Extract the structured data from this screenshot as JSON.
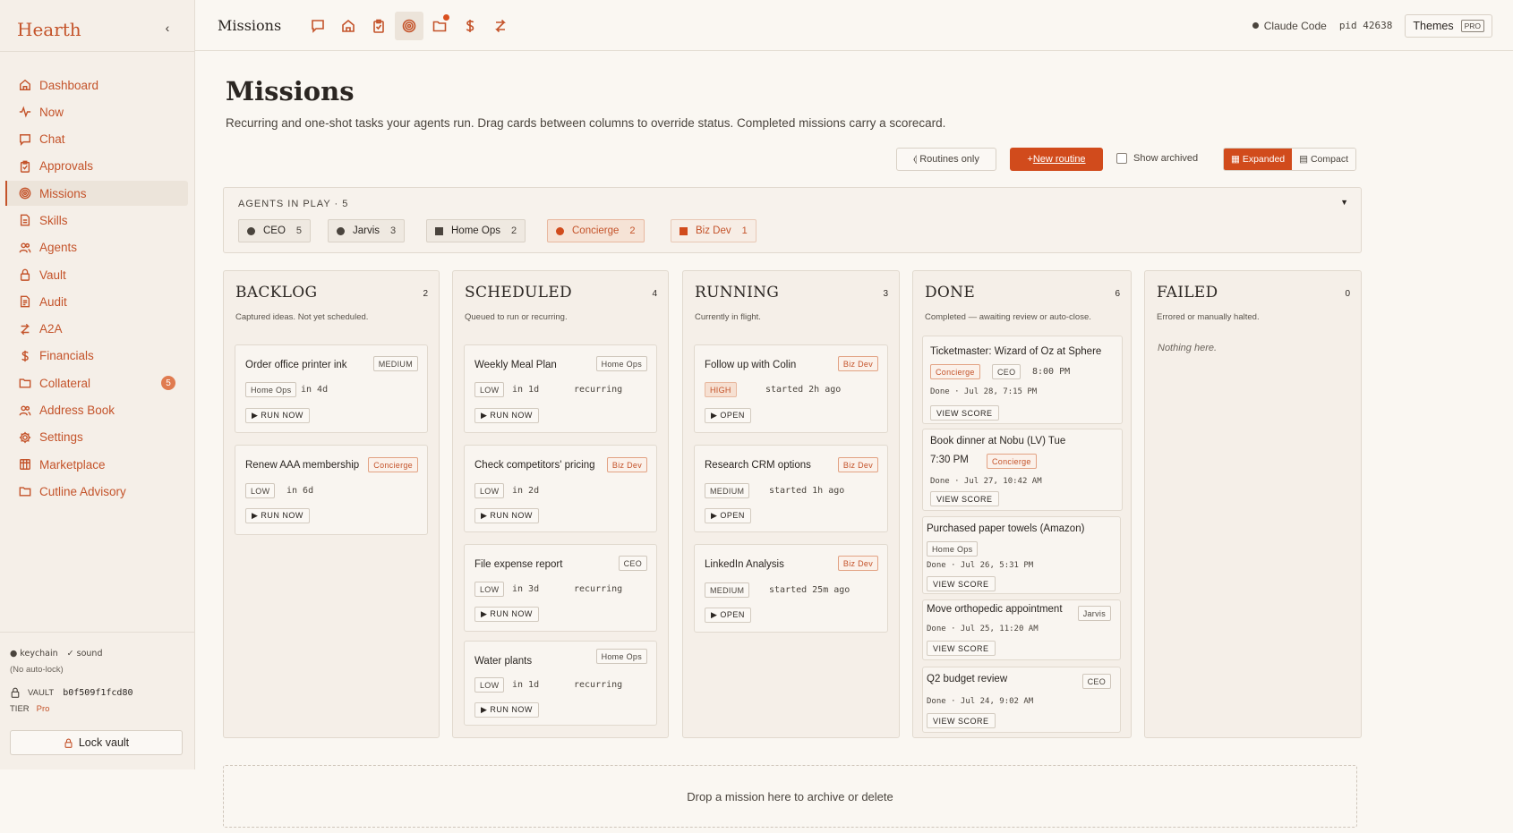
{
  "app": {
    "brand": "Hearth",
    "collapse_glyph": "‹"
  },
  "sidebar": {
    "items": [
      {
        "label": "Dashboard",
        "icon": "home-icon"
      },
      {
        "label": "Now",
        "icon": "pulse-icon"
      },
      {
        "label": "Chat",
        "icon": "chat-icon"
      },
      {
        "label": "Approvals",
        "icon": "clipboard-icon"
      },
      {
        "label": "Missions",
        "icon": "target-icon"
      },
      {
        "label": "Skills",
        "icon": "document-icon"
      },
      {
        "label": "Agents",
        "icon": "users-icon"
      },
      {
        "label": "Vault",
        "icon": "lock-icon"
      },
      {
        "label": "Audit",
        "icon": "file-icon"
      },
      {
        "label": "A2A",
        "icon": "exchange-icon"
      },
      {
        "label": "Financials",
        "icon": "dollar-icon"
      },
      {
        "label": "Collateral",
        "icon": "folder-icon",
        "badge": "5"
      },
      {
        "label": "Address Book",
        "icon": "contacts-icon"
      },
      {
        "label": "Settings",
        "icon": "gear-icon"
      },
      {
        "label": "Marketplace",
        "icon": "store-icon"
      },
      {
        "label": "Cutline Advisory",
        "icon": "folder-icon"
      }
    ],
    "status_keychain": "● keychain",
    "status_sound": "✓ sound",
    "autolock": "(No auto-lock)",
    "vault_label": "VAULT",
    "vault_id": "b0f509f1fcd80",
    "tier_label": "TIER",
    "tier_value": "Pro",
    "lock_button": "Lock vault"
  },
  "topbar": {
    "title": "Missions",
    "session_name": "Claude Code",
    "pid": "pid 42638",
    "themes_label": "Themes",
    "themes_badge": "PRO"
  },
  "page": {
    "title": "Missions",
    "subtitle": "Recurring and one-shot tasks your agents run. Drag cards between columns to override status. Completed missions carry a scorecard."
  },
  "toolbar": {
    "routines_only": "⦉ Routines only",
    "new_routine_plus": "+ ",
    "new_routine": "New routine",
    "show_archived": "Show archived",
    "expanded": "▦ Expanded",
    "compact": "▤ Compact"
  },
  "agents": {
    "label": "AGENTS IN PLAY · 5",
    "caret": "▼",
    "chips": [
      {
        "name": "CEO",
        "count": "5"
      },
      {
        "name": "Jarvis",
        "count": "3"
      },
      {
        "name": "Home Ops",
        "count": "2"
      },
      {
        "name": "Concierge",
        "count": "2"
      },
      {
        "name": "Biz Dev",
        "count": "1"
      }
    ]
  },
  "columns": {
    "backlog": {
      "title": "BACKLOG",
      "count": "2",
      "sub": "Captured ideas. Not yet scheduled.",
      "cards": [
        {
          "title": "Order office printer ink",
          "tag": "MEDIUM",
          "agent": "Home Ops",
          "when": "in 4d",
          "action": "▶ RUN NOW"
        },
        {
          "title": "Renew AAA membership",
          "agent": "Concierge",
          "priority": "LOW",
          "when": "in 6d",
          "action": "▶ RUN NOW"
        }
      ]
    },
    "scheduled": {
      "title": "SCHEDULED",
      "count": "4",
      "sub": "Queued to run or recurring.",
      "cards": [
        {
          "title": "Weekly Meal Plan",
          "agent": "Home Ops",
          "priority": "LOW",
          "when": "in 1d",
          "recur": "recurring",
          "action": "▶ RUN NOW"
        },
        {
          "title": "Check competitors' pricing",
          "agent": "Biz Dev",
          "priority": "LOW",
          "when": "in 2d",
          "action": "▶ RUN NOW"
        },
        {
          "title": "File expense report",
          "agent": "CEO",
          "priority": "LOW",
          "when": "in 3d",
          "recur": "recurring",
          "action": "▶ RUN NOW"
        },
        {
          "title": "Water plants",
          "agent": "Home Ops",
          "priority": "LOW",
          "when": "in 1d",
          "recur": "recurring",
          "action": "▶ RUN NOW"
        }
      ]
    },
    "running": {
      "title": "RUNNING",
      "count": "3",
      "sub": "Currently in flight.",
      "cards": [
        {
          "title": "Follow up with Colin",
          "agent": "Biz Dev",
          "priority": "HIGH",
          "when": "started 2h ago",
          "action": "▶ OPEN"
        },
        {
          "title": "Research CRM options",
          "agent": "Biz Dev",
          "priority": "MEDIUM",
          "when": "started 1h ago",
          "action": "▶ OPEN"
        },
        {
          "title": "LinkedIn Analysis",
          "agent": "Biz Dev",
          "priority": "MEDIUM",
          "when": "started 25m ago",
          "action": "▶ OPEN"
        }
      ]
    },
    "done": {
      "title": "DONE",
      "count": "6",
      "sub": "Completed — awaiting review or auto-close.",
      "cards": [
        {
          "title": "Ticketmaster: Wizard of Oz at Sphere",
          "agent": "Concierge",
          "agent2": "CEO",
          "time": "8:00 PM",
          "done": "Done · Jul 28, 7:15 PM",
          "action": "VIEW SCORE"
        },
        {
          "title_l1": "Book dinner at Nobu (LV) Tue",
          "title_l2": "7:30 PM",
          "agent": "Concierge",
          "done": "Done · Jul 27, 10:42 AM",
          "action": "VIEW SCORE"
        },
        {
          "title": "Purchased paper towels (Amazon)",
          "agent": "Home Ops",
          "done": "Done · Jul 26, 5:31 PM",
          "action": "VIEW SCORE"
        },
        {
          "title": "Move orthopedic appointment",
          "agent": "Jarvis",
          "done": "Done · Jul 25, 11:20 AM",
          "action": "VIEW SCORE"
        },
        {
          "title": "Q2 budget review",
          "agent": "CEO",
          "done": "Done · Jul 24, 9:02 AM",
          "action": "VIEW SCORE"
        }
      ]
    },
    "failed": {
      "title": "FAILED",
      "count": "0",
      "sub": "Errored or manually halted.",
      "empty": "Nothing here."
    }
  },
  "dropzone": "Drop a mission here to archive or delete",
  "colors": {
    "accent": "#c4532a",
    "primary_button": "#d14b1c",
    "background": "#faf7f2",
    "sidebar": "#f5efe8"
  }
}
